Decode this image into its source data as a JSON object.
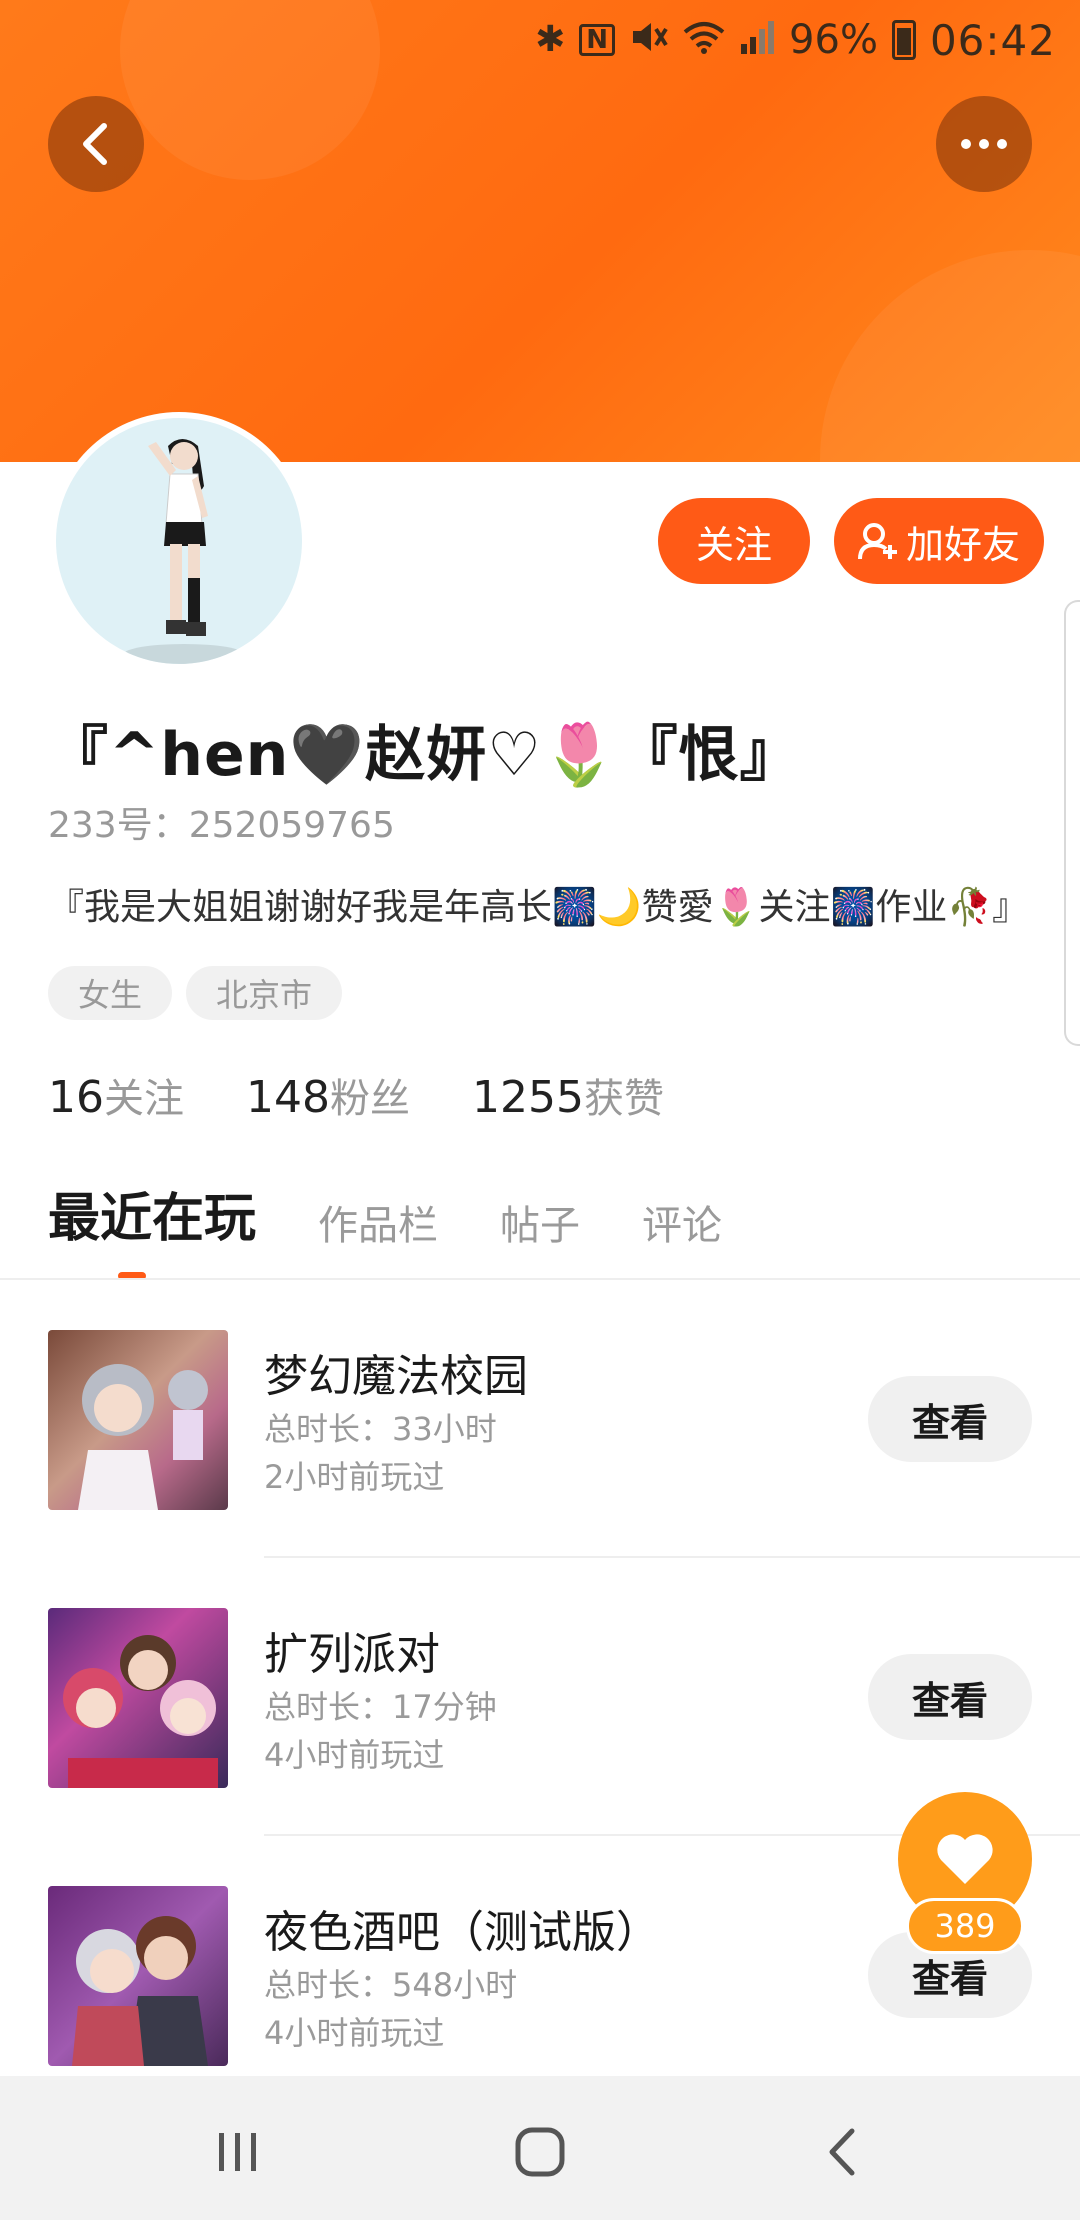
{
  "status_bar": {
    "battery": "96%",
    "time": "06:42"
  },
  "header": {
    "back_icon": "chevron-left-icon",
    "more_icon": "more-dots-icon"
  },
  "profile": {
    "name": "『^hen🖤赵妍♡🌷『恨』",
    "uid": "233号：252059765",
    "bio": "『我是大姐姐谢谢好我是年高长🎆🌙赞愛🌷关注🎆作业🥀』",
    "tags": [
      "女生",
      "北京市"
    ]
  },
  "actions": {
    "follow_label": "关注",
    "add_friend_label": "加好友"
  },
  "stats": [
    {
      "num": "16",
      "label": "关注"
    },
    {
      "num": "148",
      "label": "粉丝"
    },
    {
      "num": "1255",
      "label": "获赞"
    }
  ],
  "tabs": [
    "最近在玩",
    "作品栏",
    "帖子",
    "评论"
  ],
  "games": [
    {
      "title": "梦幻魔法校园",
      "duration": "总时长：33小时",
      "last_played": "2小时前玩过",
      "button": "查看"
    },
    {
      "title": "扩列派对",
      "duration": "总时长：17分钟",
      "last_played": "4小时前玩过",
      "button": "查看"
    },
    {
      "title": "夜色酒吧（测试版）",
      "duration": "总时长：548小时",
      "last_played": "4小时前玩过",
      "button": "查看"
    }
  ],
  "like_fab": {
    "count": "389"
  },
  "colors": {
    "accent": "#ff5a16",
    "header": "#ff7a1a",
    "fab": "#ff9c1a"
  }
}
